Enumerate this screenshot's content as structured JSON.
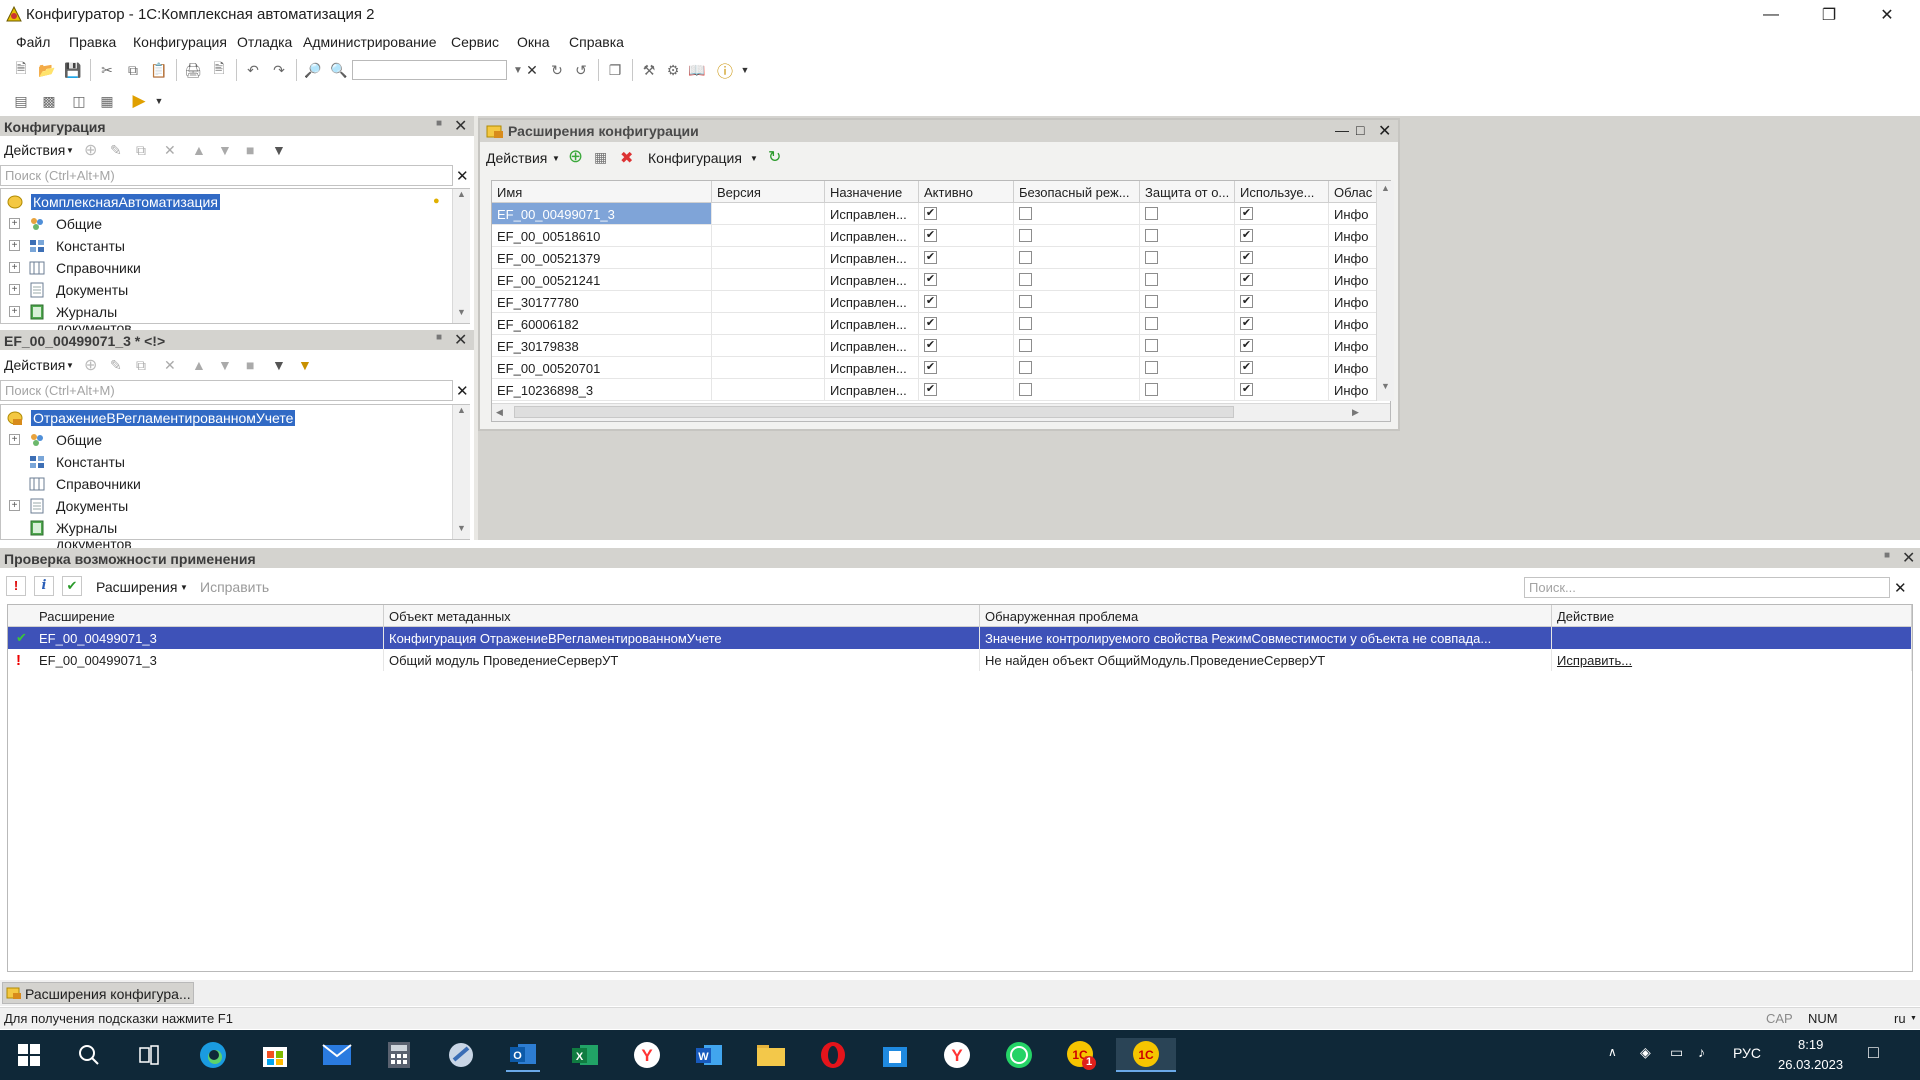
{
  "window": {
    "title": "Конфигуратор - 1С:Комплексная автоматизация 2",
    "min_icon": "minimize-icon",
    "max_icon": "restore-icon",
    "close_icon": "close-icon"
  },
  "menu": [
    "Файл",
    "Правка",
    "Конфигурация",
    "Отладка",
    "Администрирование",
    "Сервис",
    "Окна",
    "Справка"
  ],
  "config_panel": {
    "title": "Конфигурация",
    "actions_label": "Действия",
    "search_placeholder": "Поиск (Ctrl+Alt+M)",
    "tree": [
      {
        "label": "КомплекснаяАвтоматизация",
        "icon": "config-root-icon",
        "selected": true
      },
      {
        "label": "Общие",
        "icon": "common-icon"
      },
      {
        "label": "Константы",
        "icon": "constants-icon"
      },
      {
        "label": "Справочники",
        "icon": "catalogs-icon"
      },
      {
        "label": "Документы",
        "icon": "documents-icon"
      },
      {
        "label": "Журналы документов",
        "icon": "journals-icon"
      }
    ]
  },
  "ext_panel": {
    "title": "EF_00_00499071_3 * <!>",
    "actions_label": "Действия",
    "search_placeholder": "Поиск (Ctrl+Alt+M)",
    "tree": [
      {
        "label": "ОтражениеВРегламентированномУчете",
        "icon": "extension-root-icon",
        "selected": true
      },
      {
        "label": "Общие",
        "icon": "common-icon"
      },
      {
        "label": "Константы",
        "icon": "constants-icon"
      },
      {
        "label": "Справочники",
        "icon": "catalogs-icon"
      },
      {
        "label": "Документы",
        "icon": "documents-icon"
      },
      {
        "label": "Журналы документов",
        "icon": "journals-icon"
      }
    ]
  },
  "extensions_window": {
    "title": "Расширения конфигурации",
    "actions_label": "Действия",
    "config_label": "Конфигурация",
    "columns": [
      "Имя",
      "Версия",
      "Назначение",
      "Активно",
      "Безопасный реж...",
      "Защита от о...",
      "Используе...",
      "Облас"
    ],
    "rows": [
      {
        "name": "EF_00_00499071_3",
        "version": "",
        "purpose": "Исправлен...",
        "active": true,
        "safe": false,
        "protect": false,
        "used": true,
        "area": "Инфо",
        "selected": true
      },
      {
        "name": "EF_00_00518610",
        "version": "",
        "purpose": "Исправлен...",
        "active": true,
        "safe": false,
        "protect": false,
        "used": true,
        "area": "Инфо"
      },
      {
        "name": "EF_00_00521379",
        "version": "",
        "purpose": "Исправлен...",
        "active": true,
        "safe": false,
        "protect": false,
        "used": true,
        "area": "Инфо"
      },
      {
        "name": "EF_00_00521241",
        "version": "",
        "purpose": "Исправлен...",
        "active": true,
        "safe": false,
        "protect": false,
        "used": true,
        "area": "Инфо"
      },
      {
        "name": "EF_30177780",
        "version": "",
        "purpose": "Исправлен...",
        "active": true,
        "safe": false,
        "protect": false,
        "used": true,
        "area": "Инфо"
      },
      {
        "name": "EF_60006182",
        "version": "",
        "purpose": "Исправлен...",
        "active": true,
        "safe": false,
        "protect": false,
        "used": true,
        "area": "Инфо"
      },
      {
        "name": "EF_30179838",
        "version": "",
        "purpose": "Исправлен...",
        "active": true,
        "safe": false,
        "protect": false,
        "used": true,
        "area": "Инфо"
      },
      {
        "name": "EF_00_00520701",
        "version": "",
        "purpose": "Исправлен...",
        "active": true,
        "safe": false,
        "protect": false,
        "used": true,
        "area": "Инфо"
      },
      {
        "name": "EF_10236898_3",
        "version": "",
        "purpose": "Исправлен...",
        "active": true,
        "safe": false,
        "protect": false,
        "used": true,
        "area": "Инфо"
      }
    ]
  },
  "check_panel": {
    "title": "Проверка возможности применения",
    "extensions_label": "Расширения",
    "fix_label": "Исправить",
    "search_placeholder": "Поиск...",
    "columns": [
      "Расширение",
      "Объект метаданных",
      "Обнаруженная проблема",
      "Действие"
    ],
    "rows": [
      {
        "status": "ok",
        "extension": "EF_00_00499071_3",
        "object": "Конфигурация ОтражениеВРегламентированномУчете",
        "problem": "Значение контролируемого свойства РежимСовместимости у объекта  не совпада...",
        "action": "",
        "selected": true
      },
      {
        "status": "error",
        "extension": "EF_00_00499071_3",
        "object": "Общий модуль ПроведениеСерверУТ",
        "problem": "Не найден объект ОбщийМодуль.ПроведениеСерверУТ",
        "action": "Исправить..."
      }
    ]
  },
  "tabs": [
    {
      "label": "Расширения конфигура..."
    }
  ],
  "status": {
    "hint": "Для получения подсказки нажмите F1",
    "cap": "CAP",
    "num": "NUM",
    "lang": "ru"
  },
  "taskbar": {
    "apps": [
      "windows-start-icon",
      "search-icon",
      "task-view-icon",
      "edge-icon",
      "store-icon",
      "mail-icon",
      "calculator-icon",
      "app-icon",
      "outlook-icon",
      "excel-icon",
      "yandex-icon",
      "word-icon",
      "explorer-icon",
      "opera-icon",
      "store2-icon",
      "yandex-browser-icon",
      "whatsapp-icon",
      "1c-notify-icon",
      "1c-icon"
    ],
    "lang": "РУС",
    "time": "8:19",
    "date": "26.03.2023",
    "badge": "1"
  }
}
